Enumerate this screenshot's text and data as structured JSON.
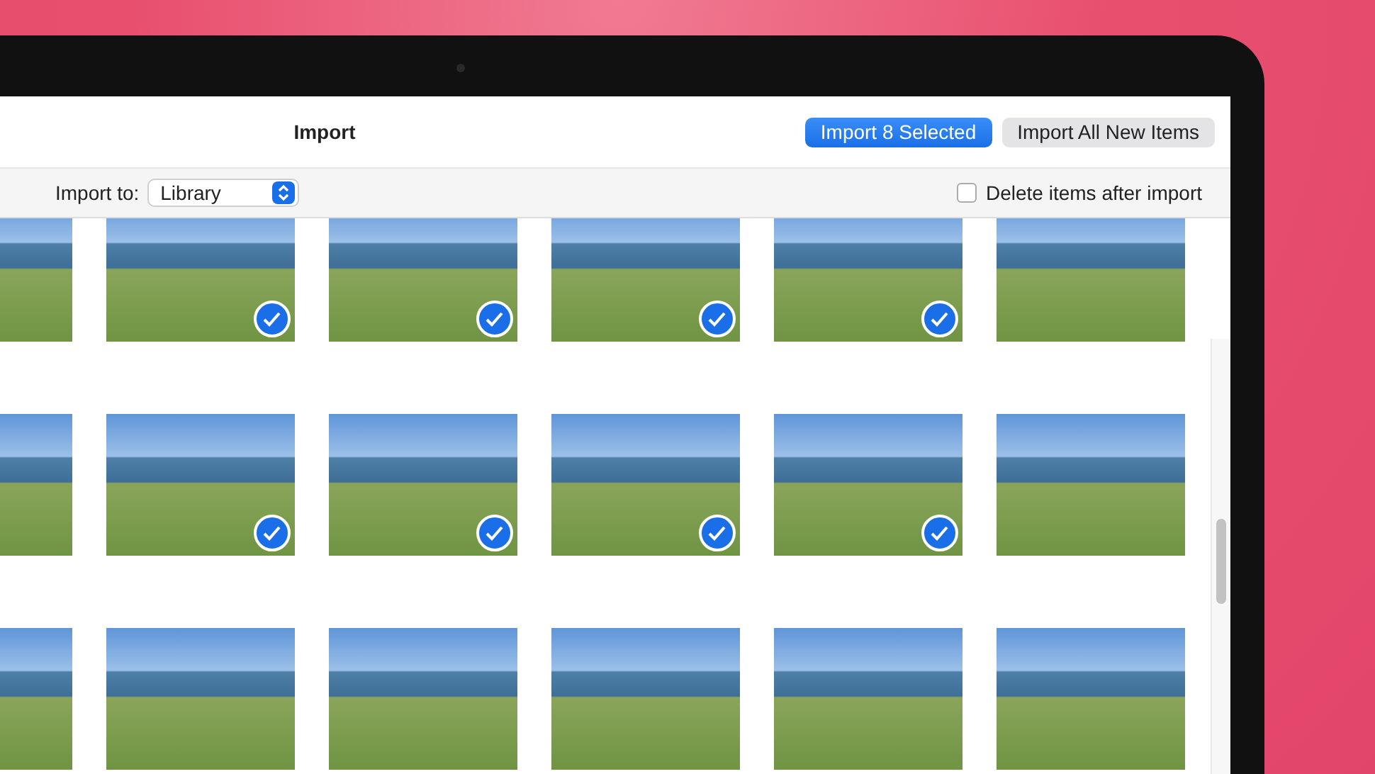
{
  "window": {
    "title": "Import"
  },
  "buttons": [
    {
      "label": "Import 8 Selected",
      "kind": "primary"
    },
    {
      "label": "Import All New Items",
      "kind": "secondary"
    }
  ],
  "import_to": {
    "label": "Import to:",
    "value": "Library"
  },
  "delete_after_import": {
    "label": "Delete items after import",
    "checked": false
  },
  "grid": [
    {
      "photos": [
        {
          "selected": false
        },
        {
          "selected": true
        },
        {
          "selected": true
        },
        {
          "selected": true
        },
        {
          "selected": true
        },
        {
          "selected": false
        }
      ]
    },
    {
      "photos": [
        {
          "selected": false
        },
        {
          "selected": true
        },
        {
          "selected": true
        },
        {
          "selected": true
        },
        {
          "selected": true
        },
        {
          "selected": false
        }
      ]
    },
    {
      "photos": [
        {
          "selected": false
        },
        {
          "selected": false
        },
        {
          "selected": false
        },
        {
          "selected": false
        },
        {
          "selected": false
        },
        {
          "selected": false
        }
      ]
    }
  ]
}
